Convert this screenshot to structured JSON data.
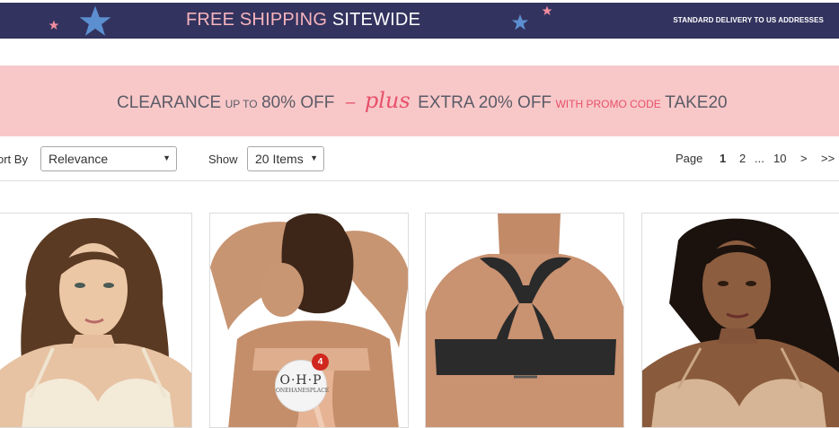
{
  "shipping_banner": {
    "title_highlight": "FREE SHIPPING",
    "title_rest": "SITEWIDE",
    "subtitle": "STANDARD DELIVERY TO US ADDRESSES",
    "colors": {
      "background": "#33335f",
      "highlight": "#f6b4bd",
      "star_blue": "#5b8fd0",
      "star_pink": "#f08c9e"
    }
  },
  "clearance_banner": {
    "part1": "CLEARANCE",
    "part2": "UP TO",
    "part3": "80% OFF",
    "dash": "–",
    "plus": "plus",
    "part4": "EXTRA 20% OFF",
    "part5": "WITH PROMO CODE",
    "code": "TAKE20",
    "colors": {
      "background": "#f8c8c9",
      "accent": "#e8506a"
    }
  },
  "toolbar": {
    "sort_label": "ort By",
    "sort_value": "Relevance",
    "show_label": "Show",
    "show_value": "20 Items",
    "dropdown_icon": "caret-down-icon",
    "pagination": {
      "label": "Page",
      "current": "1",
      "next_page": "2",
      "ellipsis": "...",
      "last_page": "10",
      "next": ">",
      "last": ">>"
    }
  },
  "products": [
    {
      "image": "woman-wearing-ivory-tshirt-bra"
    },
    {
      "image": "back-view-woman-nude-lace-bra",
      "badge_logo": "O·H·P",
      "badge_tag": "ONEHANESPLACE",
      "badge_count": "4"
    },
    {
      "image": "back-view-black-racerback-sports-bra"
    },
    {
      "image": "woman-wearing-nude-plunge-bra"
    }
  ]
}
